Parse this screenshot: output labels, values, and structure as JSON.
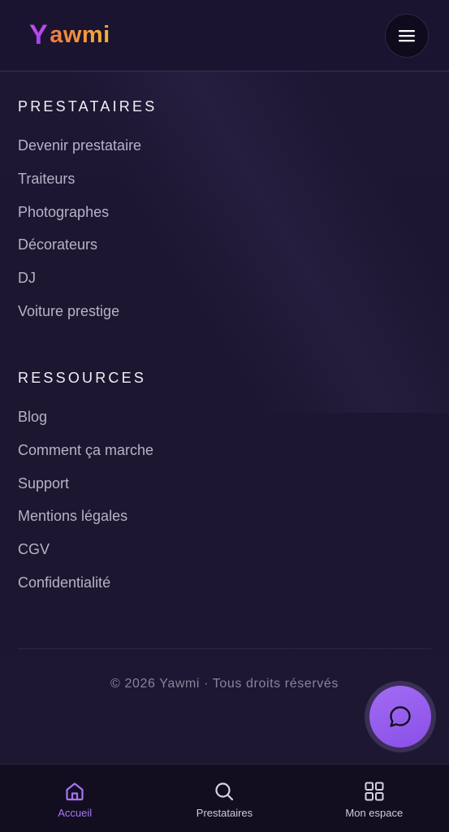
{
  "header": {
    "logo_initial": "Y",
    "logo_rest": "awmi",
    "menu_icon": "hamburger-icon"
  },
  "sections": [
    {
      "title": "PRESTATAIRES",
      "links": [
        "Devenir prestataire",
        "Traiteurs",
        "Photographes",
        "Décorateurs",
        "DJ",
        "Voiture prestige"
      ]
    },
    {
      "title": "RESSOURCES",
      "links": [
        "Blog",
        "Comment ça marche",
        "Support",
        "Mentions légales",
        "CGV",
        "Confidentialité"
      ]
    }
  ],
  "footer": {
    "copyright": "© 2026 Yawmi · Tous droits réservés"
  },
  "chat_fab": {
    "icon": "chat-bubble-icon"
  },
  "bottom_nav": {
    "items": [
      {
        "label": "Accueil",
        "icon": "home-icon",
        "active": true
      },
      {
        "label": "Prestataires",
        "icon": "search-icon",
        "active": false
      },
      {
        "label": "Mon espace",
        "icon": "dashboard-grid-icon",
        "active": false
      }
    ]
  },
  "colors": {
    "accent": "#a775f5",
    "background": "#1c1631",
    "nav_background": "#120e20"
  }
}
